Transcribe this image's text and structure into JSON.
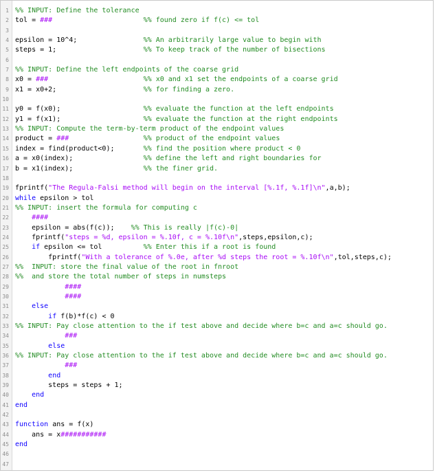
{
  "colors": {
    "keyword": "#0e00ff",
    "comment": "#228b22",
    "string": "#a709f5",
    "text": "#000000",
    "line_number": "#8c8c8c",
    "gutter_background": "#f3f3f3"
  },
  "editor": {
    "lines": [
      {
        "n": "1",
        "segs": [
          {
            "t": "%% INPUT: Define the tolerance",
            "c": "cm"
          }
        ]
      },
      {
        "n": "2",
        "segs": [
          {
            "t": "tol = "
          },
          {
            "t": "###",
            "c": "st"
          },
          {
            "t": "                      "
          },
          {
            "t": "%% found zero if f(c) <= tol",
            "c": "cm"
          }
        ]
      },
      {
        "n": "3",
        "segs": []
      },
      {
        "n": "4",
        "segs": [
          {
            "t": "epsilon = 10^4;                "
          },
          {
            "t": "%% An arbitrarily large value to begin with",
            "c": "cm"
          }
        ]
      },
      {
        "n": "5",
        "segs": [
          {
            "t": "steps = 1;                     "
          },
          {
            "t": "%% To keep track of the number of bisections",
            "c": "cm"
          }
        ]
      },
      {
        "n": "6",
        "segs": []
      },
      {
        "n": "7",
        "segs": [
          {
            "t": "%% INPUT: Define the left endpoints of the coarse grid",
            "c": "cm"
          }
        ]
      },
      {
        "n": "8",
        "segs": [
          {
            "t": "x0 = "
          },
          {
            "t": "###",
            "c": "st"
          },
          {
            "t": "                       "
          },
          {
            "t": "%% x0 and x1 set the endpoints of a coarse grid",
            "c": "cm"
          }
        ]
      },
      {
        "n": "9",
        "segs": [
          {
            "t": "x1 = x0+2;                     "
          },
          {
            "t": "%% for finding a zero.",
            "c": "cm"
          }
        ]
      },
      {
        "n": "10",
        "segs": []
      },
      {
        "n": "11",
        "segs": [
          {
            "t": "y0 = f(x0);                    "
          },
          {
            "t": "%% evaluate the function at the left endpoints",
            "c": "cm"
          }
        ]
      },
      {
        "n": "12",
        "segs": [
          {
            "t": "y1 = f(x1);                    "
          },
          {
            "t": "%% evaluate the function at the right endpoints",
            "c": "cm"
          }
        ]
      },
      {
        "n": "13",
        "segs": [
          {
            "t": "%% INPUT: Compute the term-by-term product of the endpoint values",
            "c": "cm"
          }
        ]
      },
      {
        "n": "14",
        "segs": [
          {
            "t": "product = "
          },
          {
            "t": "###",
            "c": "st"
          },
          {
            "t": "                  "
          },
          {
            "t": "%% product of the endpoint values",
            "c": "cm"
          }
        ]
      },
      {
        "n": "15",
        "segs": [
          {
            "t": "index = find(product<0);       "
          },
          {
            "t": "%% find the position where product < 0",
            "c": "cm"
          }
        ]
      },
      {
        "n": "16",
        "segs": [
          {
            "t": "a = x0(index);                 "
          },
          {
            "t": "%% define the left and right boundaries for",
            "c": "cm"
          }
        ]
      },
      {
        "n": "17",
        "segs": [
          {
            "t": "b = x1(index);                 "
          },
          {
            "t": "%% the finer grid.",
            "c": "cm"
          }
        ]
      },
      {
        "n": "18",
        "segs": []
      },
      {
        "n": "19",
        "segs": [
          {
            "t": "fprintf("
          },
          {
            "t": "\"The Regula-Falsi method will begin on the interval [%.1f, %.1f]\\n\"",
            "c": "st"
          },
          {
            "t": ",a,b);"
          }
        ]
      },
      {
        "n": "20",
        "segs": [
          {
            "t": "while",
            "c": "kw"
          },
          {
            "t": " epsilon > tol"
          }
        ]
      },
      {
        "n": "21",
        "segs": [
          {
            "t": "%% INPUT: insert the formula for computing c",
            "c": "cm"
          }
        ]
      },
      {
        "n": "22",
        "segs": [
          {
            "t": "    "
          },
          {
            "t": "####",
            "c": "st"
          }
        ]
      },
      {
        "n": "23",
        "segs": [
          {
            "t": "    epsilon = abs(f(c));    "
          },
          {
            "t": "%% This is really |f(c)-0|",
            "c": "cm"
          }
        ]
      },
      {
        "n": "24",
        "segs": [
          {
            "t": "    fprintf("
          },
          {
            "t": "\"steps = %d, epsilon = %.10f, c = %.10f\\n\"",
            "c": "st"
          },
          {
            "t": ",steps,epsilon,c);"
          }
        ]
      },
      {
        "n": "25",
        "segs": [
          {
            "t": "    "
          },
          {
            "t": "if",
            "c": "kw"
          },
          {
            "t": " epsilon <= tol          "
          },
          {
            "t": "%% Enter this if a root is found",
            "c": "cm"
          }
        ]
      },
      {
        "n": "26",
        "segs": [
          {
            "t": "        fprintf("
          },
          {
            "t": "\"With a tolerance of %.0e, after %d steps the root = %.10f\\n\"",
            "c": "st"
          },
          {
            "t": ",tol,steps,c);"
          }
        ]
      },
      {
        "n": "27",
        "segs": [
          {
            "t": "%%  INPUT: store the final value of the root in fnroot",
            "c": "cm"
          }
        ]
      },
      {
        "n": "28",
        "segs": [
          {
            "t": "%%  and store the total number of steps in numsteps",
            "c": "cm"
          }
        ]
      },
      {
        "n": "29",
        "segs": [
          {
            "t": "            "
          },
          {
            "t": "####",
            "c": "st"
          }
        ]
      },
      {
        "n": "30",
        "segs": [
          {
            "t": "            "
          },
          {
            "t": "####",
            "c": "st"
          }
        ]
      },
      {
        "n": "31",
        "segs": [
          {
            "t": "    "
          },
          {
            "t": "else",
            "c": "kw"
          }
        ]
      },
      {
        "n": "32",
        "segs": [
          {
            "t": "        "
          },
          {
            "t": "if",
            "c": "kw"
          },
          {
            "t": " f(b)*f(c) < 0"
          }
        ]
      },
      {
        "n": "33",
        "segs": [
          {
            "t": "%% INPUT: Pay close attention to the if test above and decide where b=c and a=c should go.",
            "c": "cm"
          }
        ]
      },
      {
        "n": "34",
        "segs": [
          {
            "t": "            "
          },
          {
            "t": "###",
            "c": "st"
          }
        ]
      },
      {
        "n": "35",
        "segs": [
          {
            "t": "        "
          },
          {
            "t": "else",
            "c": "kw"
          }
        ]
      },
      {
        "n": "36",
        "segs": [
          {
            "t": "%% INPUT: Pay close attention to the if test above and decide where b=c and a=c should go.",
            "c": "cm"
          }
        ]
      },
      {
        "n": "37",
        "segs": [
          {
            "t": "            "
          },
          {
            "t": "###",
            "c": "st"
          }
        ]
      },
      {
        "n": "38",
        "segs": [
          {
            "t": "        "
          },
          {
            "t": "end",
            "c": "kw"
          }
        ]
      },
      {
        "n": "39",
        "segs": [
          {
            "t": "        steps = steps + 1;"
          }
        ]
      },
      {
        "n": "40",
        "segs": [
          {
            "t": "    "
          },
          {
            "t": "end",
            "c": "kw"
          }
        ]
      },
      {
        "n": "41",
        "segs": [
          {
            "t": "end",
            "c": "kw"
          }
        ]
      },
      {
        "n": "42",
        "segs": []
      },
      {
        "n": "43",
        "segs": [
          {
            "t": "function",
            "c": "kw"
          },
          {
            "t": " ans = f(x)"
          }
        ]
      },
      {
        "n": "44",
        "segs": [
          {
            "t": "    ans = x"
          },
          {
            "t": "###########",
            "c": "st"
          }
        ]
      },
      {
        "n": "45",
        "segs": [
          {
            "t": "end",
            "c": "kw"
          }
        ]
      },
      {
        "n": "46",
        "segs": []
      },
      {
        "n": "47",
        "segs": []
      }
    ]
  }
}
